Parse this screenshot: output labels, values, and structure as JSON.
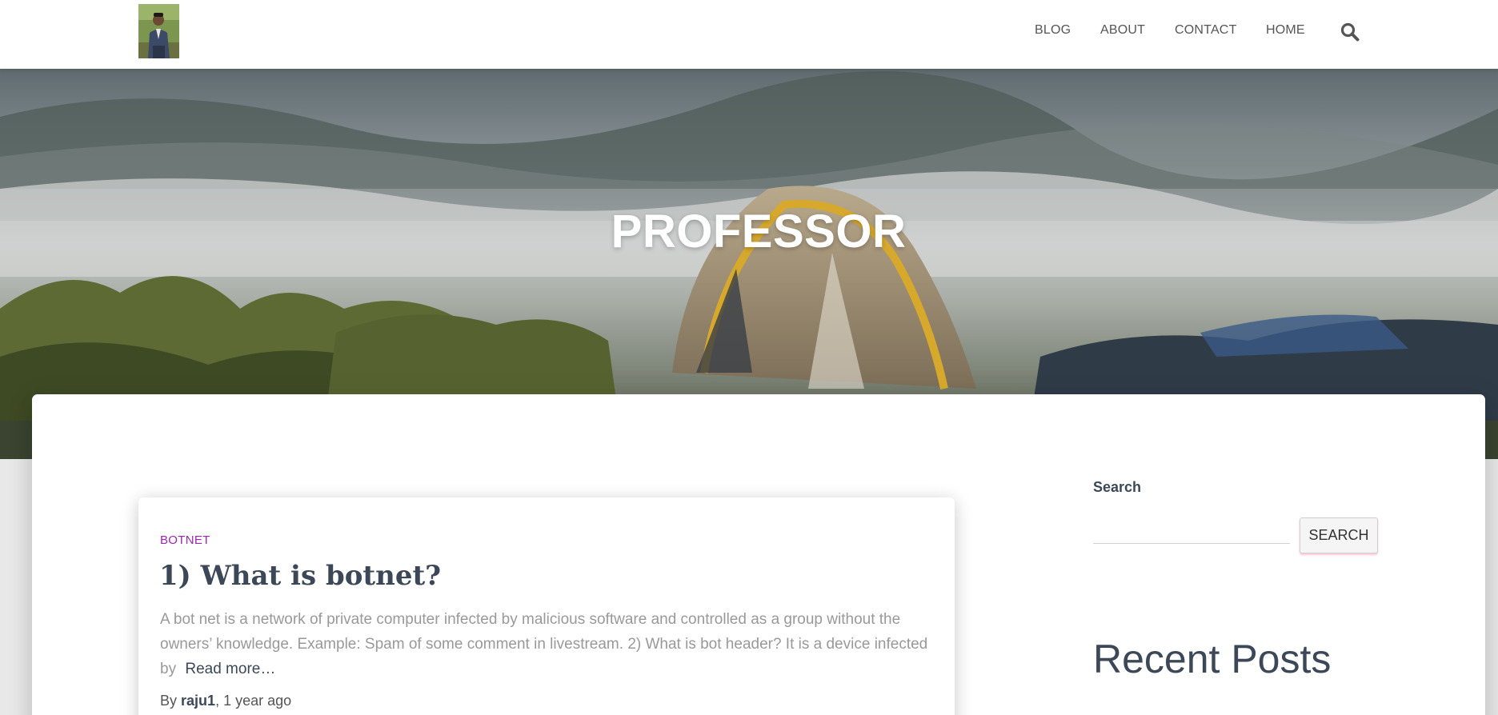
{
  "header": {
    "logo_icon": "author-avatar-icon",
    "nav": {
      "blog": "BLOG",
      "about": "ABOUT",
      "contact": "CONTACT",
      "home": "HOME"
    },
    "search_icon": "search-icon"
  },
  "hero": {
    "title": "PROFESSOR"
  },
  "post": {
    "category": "BOTNET",
    "title": "1) What is botnet?",
    "excerpt": "A bot net is a network of private computer infected by malicious software and controlled as a group without the owners’ knowledge. Example: Spam of some comment in livestream. 2) What is bot header? It is a device infected by",
    "read_more": "Read more…",
    "by_label": "By",
    "author": "raju1",
    "separator": ",",
    "time_ago": "1 year ago"
  },
  "sidebar": {
    "search_heading": "Search",
    "search_placeholder": "",
    "search_button": "SEARCH",
    "recent_heading": "Recent Posts"
  },
  "colors": {
    "category": "#9c27b0",
    "heading": "#3c4858",
    "excerpt": "#999999",
    "nav": "#555555"
  }
}
